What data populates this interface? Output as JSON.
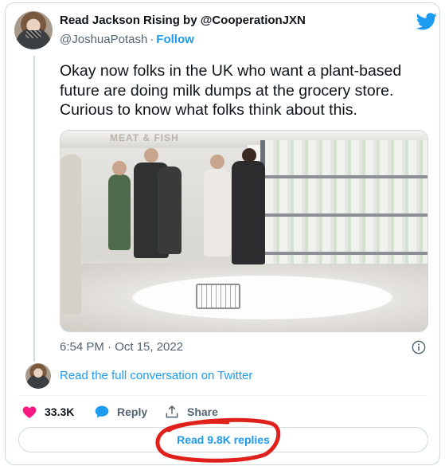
{
  "author": {
    "name": "Read Jackson Rising by @CooperationJXN",
    "handle": "@JoshuaPotash",
    "separator": "·",
    "follow_label": "Follow"
  },
  "tweet": {
    "text": "Okay now folks in the UK who want a plant-based\nfuture are doing milk dumps at the grocery store.\nCurious to know what folks think about this.",
    "media_sign_text": "MEAT & FISH",
    "timestamp": "6:54 PM · Oct 15, 2022"
  },
  "conversation": {
    "read_full_label": "Read the full conversation on Twitter"
  },
  "actions": {
    "like_count": "33.3K",
    "reply_label": "Reply",
    "share_label": "Share"
  },
  "replies": {
    "read_replies_label": "Read 9.8K replies"
  },
  "colors": {
    "accent": "#1d9bf0",
    "like": "#f91880",
    "annotation": "#e0201b"
  }
}
